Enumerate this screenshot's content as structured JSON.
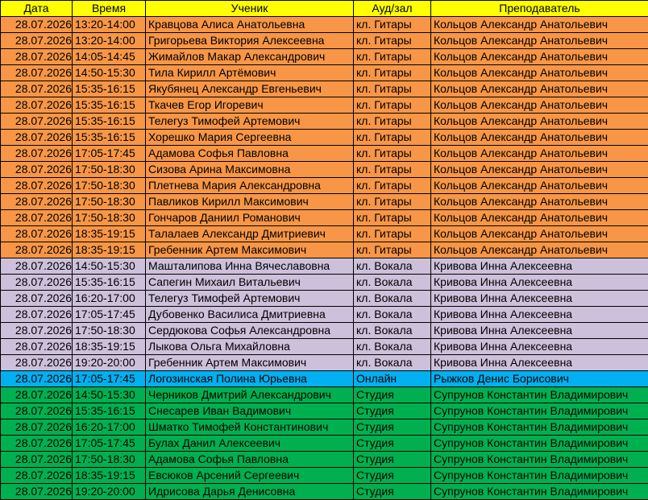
{
  "headers": {
    "date": "Дата",
    "time": "Время",
    "student": "Ученик",
    "room": "Ауд/зал",
    "teacher": "Преподаватель"
  },
  "colors": {
    "header": "#ffff00",
    "guitar": "#f79646",
    "vocal": "#ccc0da",
    "online": "#00b0f0",
    "studio": "#00b050"
  },
  "rows": [
    {
      "date": "28.07.2026",
      "time": "13:20-14:00",
      "student": "Кравцова Алиса Анатольевна",
      "room": "кл. Гитары",
      "teacher": "Кольцов Александр Анатольевич",
      "group": "guitar"
    },
    {
      "date": "28.07.2026",
      "time": "13:20-14:00",
      "student": "Григорьева Виктория Алексеевна",
      "room": "кл. Гитары",
      "teacher": "Кольцов Александр Анатольевич",
      "group": "guitar"
    },
    {
      "date": "28.07.2026",
      "time": "14:05-14:45",
      "student": "Жимайлов Макар Александрович",
      "room": "кл. Гитары",
      "teacher": "Кольцов Александр Анатольевич",
      "group": "guitar"
    },
    {
      "date": "28.07.2026",
      "time": "14:50-15:30",
      "student": "Тила Кирилл Артёмович",
      "room": "кл. Гитары",
      "teacher": "Кольцов Александр Анатольевич",
      "group": "guitar"
    },
    {
      "date": "28.07.2026",
      "time": "15:35-16:15",
      "student": "Якубянец Александр Евгеньевич",
      "room": "кл. Гитары",
      "teacher": "Кольцов Александр Анатольевич",
      "group": "guitar"
    },
    {
      "date": "28.07.2026",
      "time": "15:35-16:15",
      "student": "Ткачев Егор Игоревич",
      "room": "кл. Гитары",
      "teacher": "Кольцов Александр Анатольевич",
      "group": "guitar"
    },
    {
      "date": "28.07.2026",
      "time": "15:35-16:15",
      "student": "Телегуз Тимофей Артемович",
      "room": "кл. Гитары",
      "teacher": "Кольцов Александр Анатольевич",
      "group": "guitar"
    },
    {
      "date": "28.07.2026",
      "time": "15:35-16:15",
      "student": "Хорешко Мария Сергеевна",
      "room": "кл. Гитары",
      "teacher": "Кольцов Александр Анатольевич",
      "group": "guitar"
    },
    {
      "date": "28.07.2026",
      "time": "17:05-17:45",
      "student": "Адамова Софья Павловна",
      "room": "кл. Гитары",
      "teacher": "Кольцов Александр Анатольевич",
      "group": "guitar"
    },
    {
      "date": "28.07.2026",
      "time": "17:50-18:30",
      "student": "Сизова  Арина Максимовна",
      "room": "кл. Гитары",
      "teacher": "Кольцов Александр Анатольевич",
      "group": "guitar"
    },
    {
      "date": "28.07.2026",
      "time": "17:50-18:30",
      "student": "Плетнева Мария Александровна",
      "room": "кл. Гитары",
      "teacher": "Кольцов Александр Анатольевич",
      "group": "guitar"
    },
    {
      "date": "28.07.2026",
      "time": "17:50-18:30",
      "student": "Павликов Кирилл Максимович",
      "room": "кл. Гитары",
      "teacher": "Кольцов Александр Анатольевич",
      "group": "guitar"
    },
    {
      "date": "28.07.2026",
      "time": "17:50-18:30",
      "student": "Гончаров Даниил Романович",
      "room": "кл. Гитары",
      "teacher": "Кольцов Александр Анатольевич",
      "group": "guitar"
    },
    {
      "date": "28.07.2026",
      "time": "18:35-19:15",
      "student": "Талалаев Александр Дмитриевич",
      "room": "кл. Гитары",
      "teacher": "Кольцов Александр Анатольевич",
      "group": "guitar"
    },
    {
      "date": "28.07.2026",
      "time": "18:35-19:15",
      "student": "Гребенник Артем Максимович",
      "room": "кл. Гитары",
      "teacher": "Кольцов Александр Анатольевич",
      "group": "guitar"
    },
    {
      "date": "28.07.2026",
      "time": "14:50-15:30",
      "student": "Машталипова Инна Вячеславовна",
      "room": "кл. Вокала",
      "teacher": "Кривова Инна Алексеевна",
      "group": "vocal"
    },
    {
      "date": "28.07.2026",
      "time": "15:35-16:15",
      "student": "Сапегин Михаил Витальевич",
      "room": "кл. Вокала",
      "teacher": "Кривова Инна Алексеевна",
      "group": "vocal"
    },
    {
      "date": "28.07.2026",
      "time": "16:20-17:00",
      "student": "Телегуз Тимофей Артемович",
      "room": "кл. Вокала",
      "teacher": "Кривова Инна Алексеевна",
      "group": "vocal"
    },
    {
      "date": "28.07.2026",
      "time": "17:05-17:45",
      "student": "Дубовенко Василиса Дмитриевна",
      "room": "кл. Вокала",
      "teacher": "Кривова Инна Алексеевна",
      "group": "vocal"
    },
    {
      "date": "28.07.2026",
      "time": "17:50-18:30",
      "student": "Сердюкова Софья Александровна",
      "room": "кл. Вокала",
      "teacher": "Кривова Инна Алексеевна",
      "group": "vocal"
    },
    {
      "date": "28.07.2026",
      "time": "18:35-19:15",
      "student": "Лыкова Ольга Михайловна",
      "room": "кл. Вокала",
      "teacher": "Кривова Инна Алексеевна",
      "group": "vocal"
    },
    {
      "date": "28.07.2026",
      "time": "19:20-20:00",
      "student": "Гребенник Артем Максимович",
      "room": "кл. Вокала",
      "teacher": "Кривова Инна Алексеевна",
      "group": "vocal"
    },
    {
      "date": "28.07.2026",
      "time": "17:05-17:45",
      "student": "Логозинская Полина Юрьевна",
      "room": "Онлайн",
      "teacher": "Рыжков Денис Борисович",
      "group": "online"
    },
    {
      "date": "28.07.2026",
      "time": "14:50-15:30",
      "student": "Черников Дмитрий Александрович",
      "room": "Студия",
      "teacher": "Супрунов Константин Владимирович",
      "group": "studio"
    },
    {
      "date": "28.07.2026",
      "time": "15:35-16:15",
      "student": "Снесарев Иван Вадимович",
      "room": "Студия",
      "teacher": "Супрунов Константин Владимирович",
      "group": "studio"
    },
    {
      "date": "28.07.2026",
      "time": "16:20-17:00",
      "student": "Шматко Тимофей Константинович",
      "room": "Студия",
      "teacher": "Супрунов Константин Владимирович",
      "group": "studio"
    },
    {
      "date": "28.07.2026",
      "time": "17:05-17:45",
      "student": "Булах Данил Алексеевич",
      "room": "Студия",
      "teacher": "Супрунов Константин Владимирович",
      "group": "studio"
    },
    {
      "date": "28.07.2026",
      "time": "17:50-18:30",
      "student": "Адамова Софья Павловна",
      "room": "Студия",
      "teacher": "Супрунов Константин Владимирович",
      "group": "studio"
    },
    {
      "date": "28.07.2026",
      "time": "18:35-19:15",
      "student": "Евсюков Арсений Сергеевич",
      "room": "Студия",
      "teacher": "Супрунов Константин Владимирович",
      "group": "studio"
    },
    {
      "date": "28.07.2026",
      "time": "19:20-20:00",
      "student": "Идрисова Дарья Денисовна",
      "room": "Студия",
      "teacher": "Супрунов Константин Владимирович",
      "group": "studio"
    }
  ]
}
